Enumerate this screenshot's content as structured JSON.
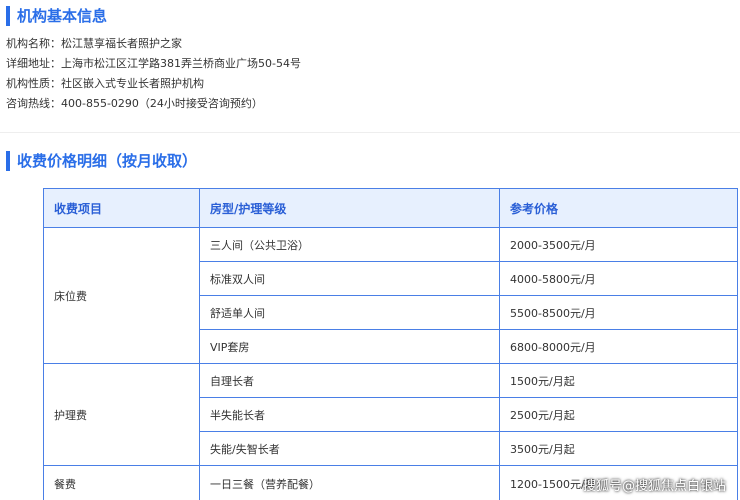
{
  "section1": {
    "title": "机构基本信息",
    "lines": [
      {
        "label": "机构名称：",
        "value": "松江慧享福长者照护之家"
      },
      {
        "label": "详细地址：",
        "value": "上海市松江区江学路381弄兰桥商业广场50-54号"
      },
      {
        "label": "机构性质：",
        "value": "社区嵌入式专业长者照护机构"
      },
      {
        "label": "咨询热线：",
        "value": "400-855-0290（24小时接受咨询预约）"
      }
    ]
  },
  "section2": {
    "title": "收费价格明细（按月收取）"
  },
  "table": {
    "headers": [
      "收费项目",
      "房型/护理等级",
      "参考价格"
    ],
    "groups": [
      {
        "category": "床位费",
        "rows": [
          {
            "item": "三人间（公共卫浴）",
            "price": "2000-3500元/月"
          },
          {
            "item": "标准双人间",
            "price": "4000-5800元/月"
          },
          {
            "item": "舒适单人间",
            "price": "5500-8500元/月"
          },
          {
            "item": "VIP套房",
            "price": "6800-8000元/月"
          }
        ]
      },
      {
        "category": "护理费",
        "rows": [
          {
            "item": "自理长者",
            "price": "1500元/月起"
          },
          {
            "item": "半失能长者",
            "price": "2500元/月起"
          },
          {
            "item": "失能/失智长者",
            "price": "3500元/月起"
          }
        ]
      },
      {
        "category": "餐费",
        "rows": [
          {
            "item": "一日三餐（营养配餐）",
            "price": "1200-1500元/月"
          }
        ]
      }
    ]
  },
  "watermark": "搜狐号@搜狐焦点白银站",
  "colors": {
    "accent": "#2a6ee8",
    "header_bg": "#e7f0fe",
    "border": "#4a7fe6"
  }
}
